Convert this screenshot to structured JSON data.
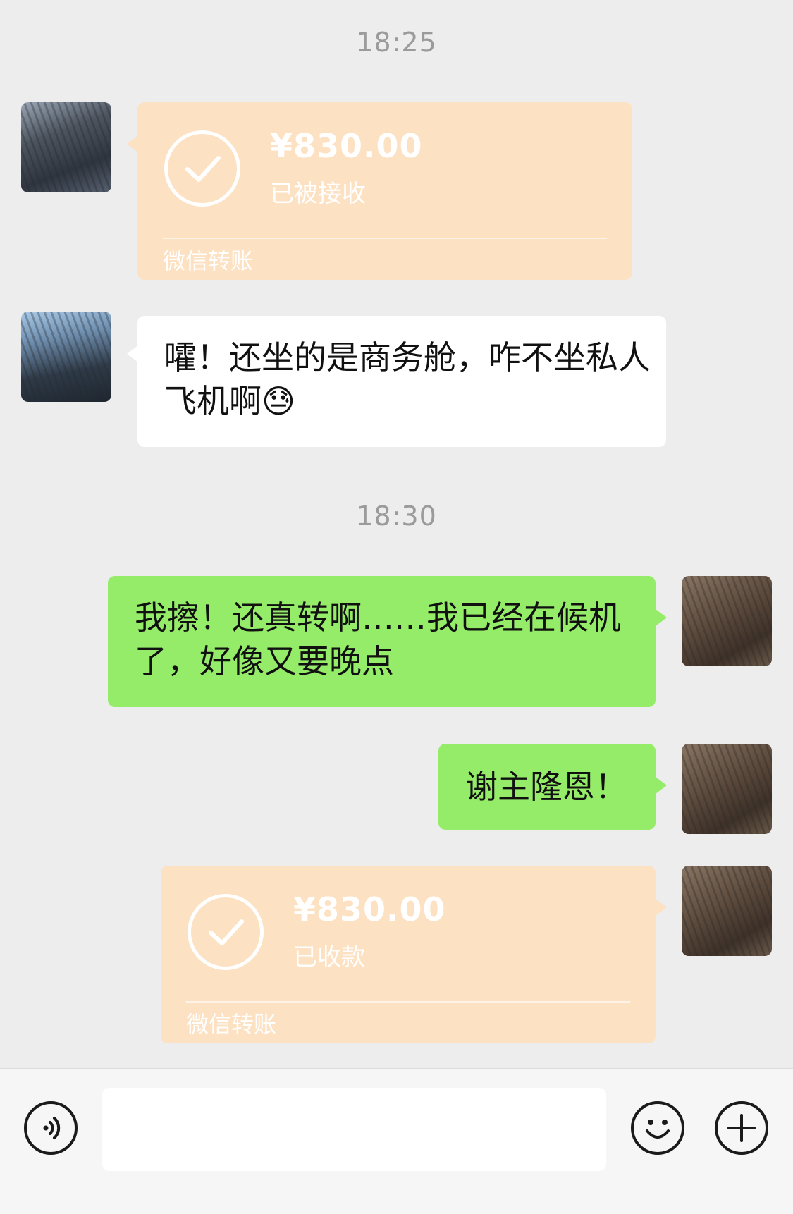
{
  "timestamps": [
    "18:25",
    "18:30"
  ],
  "transfers": [
    {
      "amount": "¥830.00",
      "status": "已被接收",
      "label": "微信转账"
    },
    {
      "amount": "¥830.00",
      "status": "已收款",
      "label": "微信转账"
    }
  ],
  "messages": {
    "incoming_text": "嚯！还坐的是商务舱，咋不坐私人飞机啊😓",
    "outgoing_1": "我擦！还真转啊……我已经在候机了，好像又要晚点",
    "outgoing_2": "谢主隆恩！"
  },
  "input": {
    "placeholder": ""
  },
  "colors": {
    "peach": "#fde1c3",
    "green": "#95ec69",
    "white": "#ffffff",
    "bg": "#ededed"
  },
  "icons": [
    "voice-icon",
    "emoji-icon",
    "plus-icon",
    "check-icon"
  ]
}
